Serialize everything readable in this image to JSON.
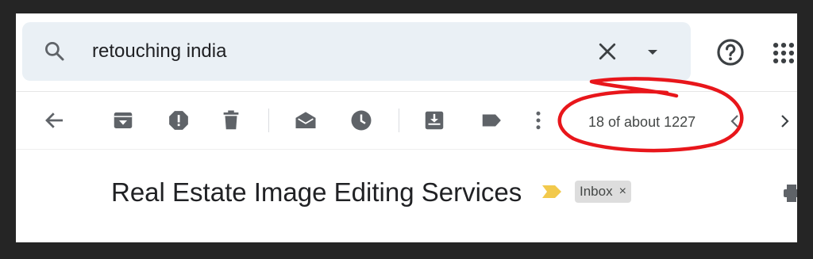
{
  "search": {
    "query": "retouching india"
  },
  "toolbar": {
    "counter_text": "18 of about 1227"
  },
  "message": {
    "subject": "Real Estate Image Editing Services",
    "labels": [
      {
        "name": "Inbox",
        "remove_glyph": "×"
      }
    ]
  },
  "icons": {
    "search": "search-icon",
    "clear": "close-icon",
    "search_options": "caret-down-icon",
    "help": "help-icon",
    "apps": "apps-grid-icon",
    "back": "arrow-left-icon",
    "archive": "archive-icon",
    "spam": "report-spam-icon",
    "delete": "trash-icon",
    "mark_unread": "mark-unread-icon",
    "snooze": "clock-icon",
    "move_to": "move-to-inbox-icon",
    "label": "label-icon",
    "more": "more-vertical-icon",
    "prev": "chevron-left-icon",
    "next": "chevron-right-icon",
    "importance": "importance-marker-icon",
    "print": "print-icon"
  },
  "colors": {
    "search_bg": "#eaf0f5",
    "icon": "#5f6368",
    "importance": "#f2c94c",
    "annotation": "#e8161b",
    "chip_bg": "#dddddd"
  }
}
